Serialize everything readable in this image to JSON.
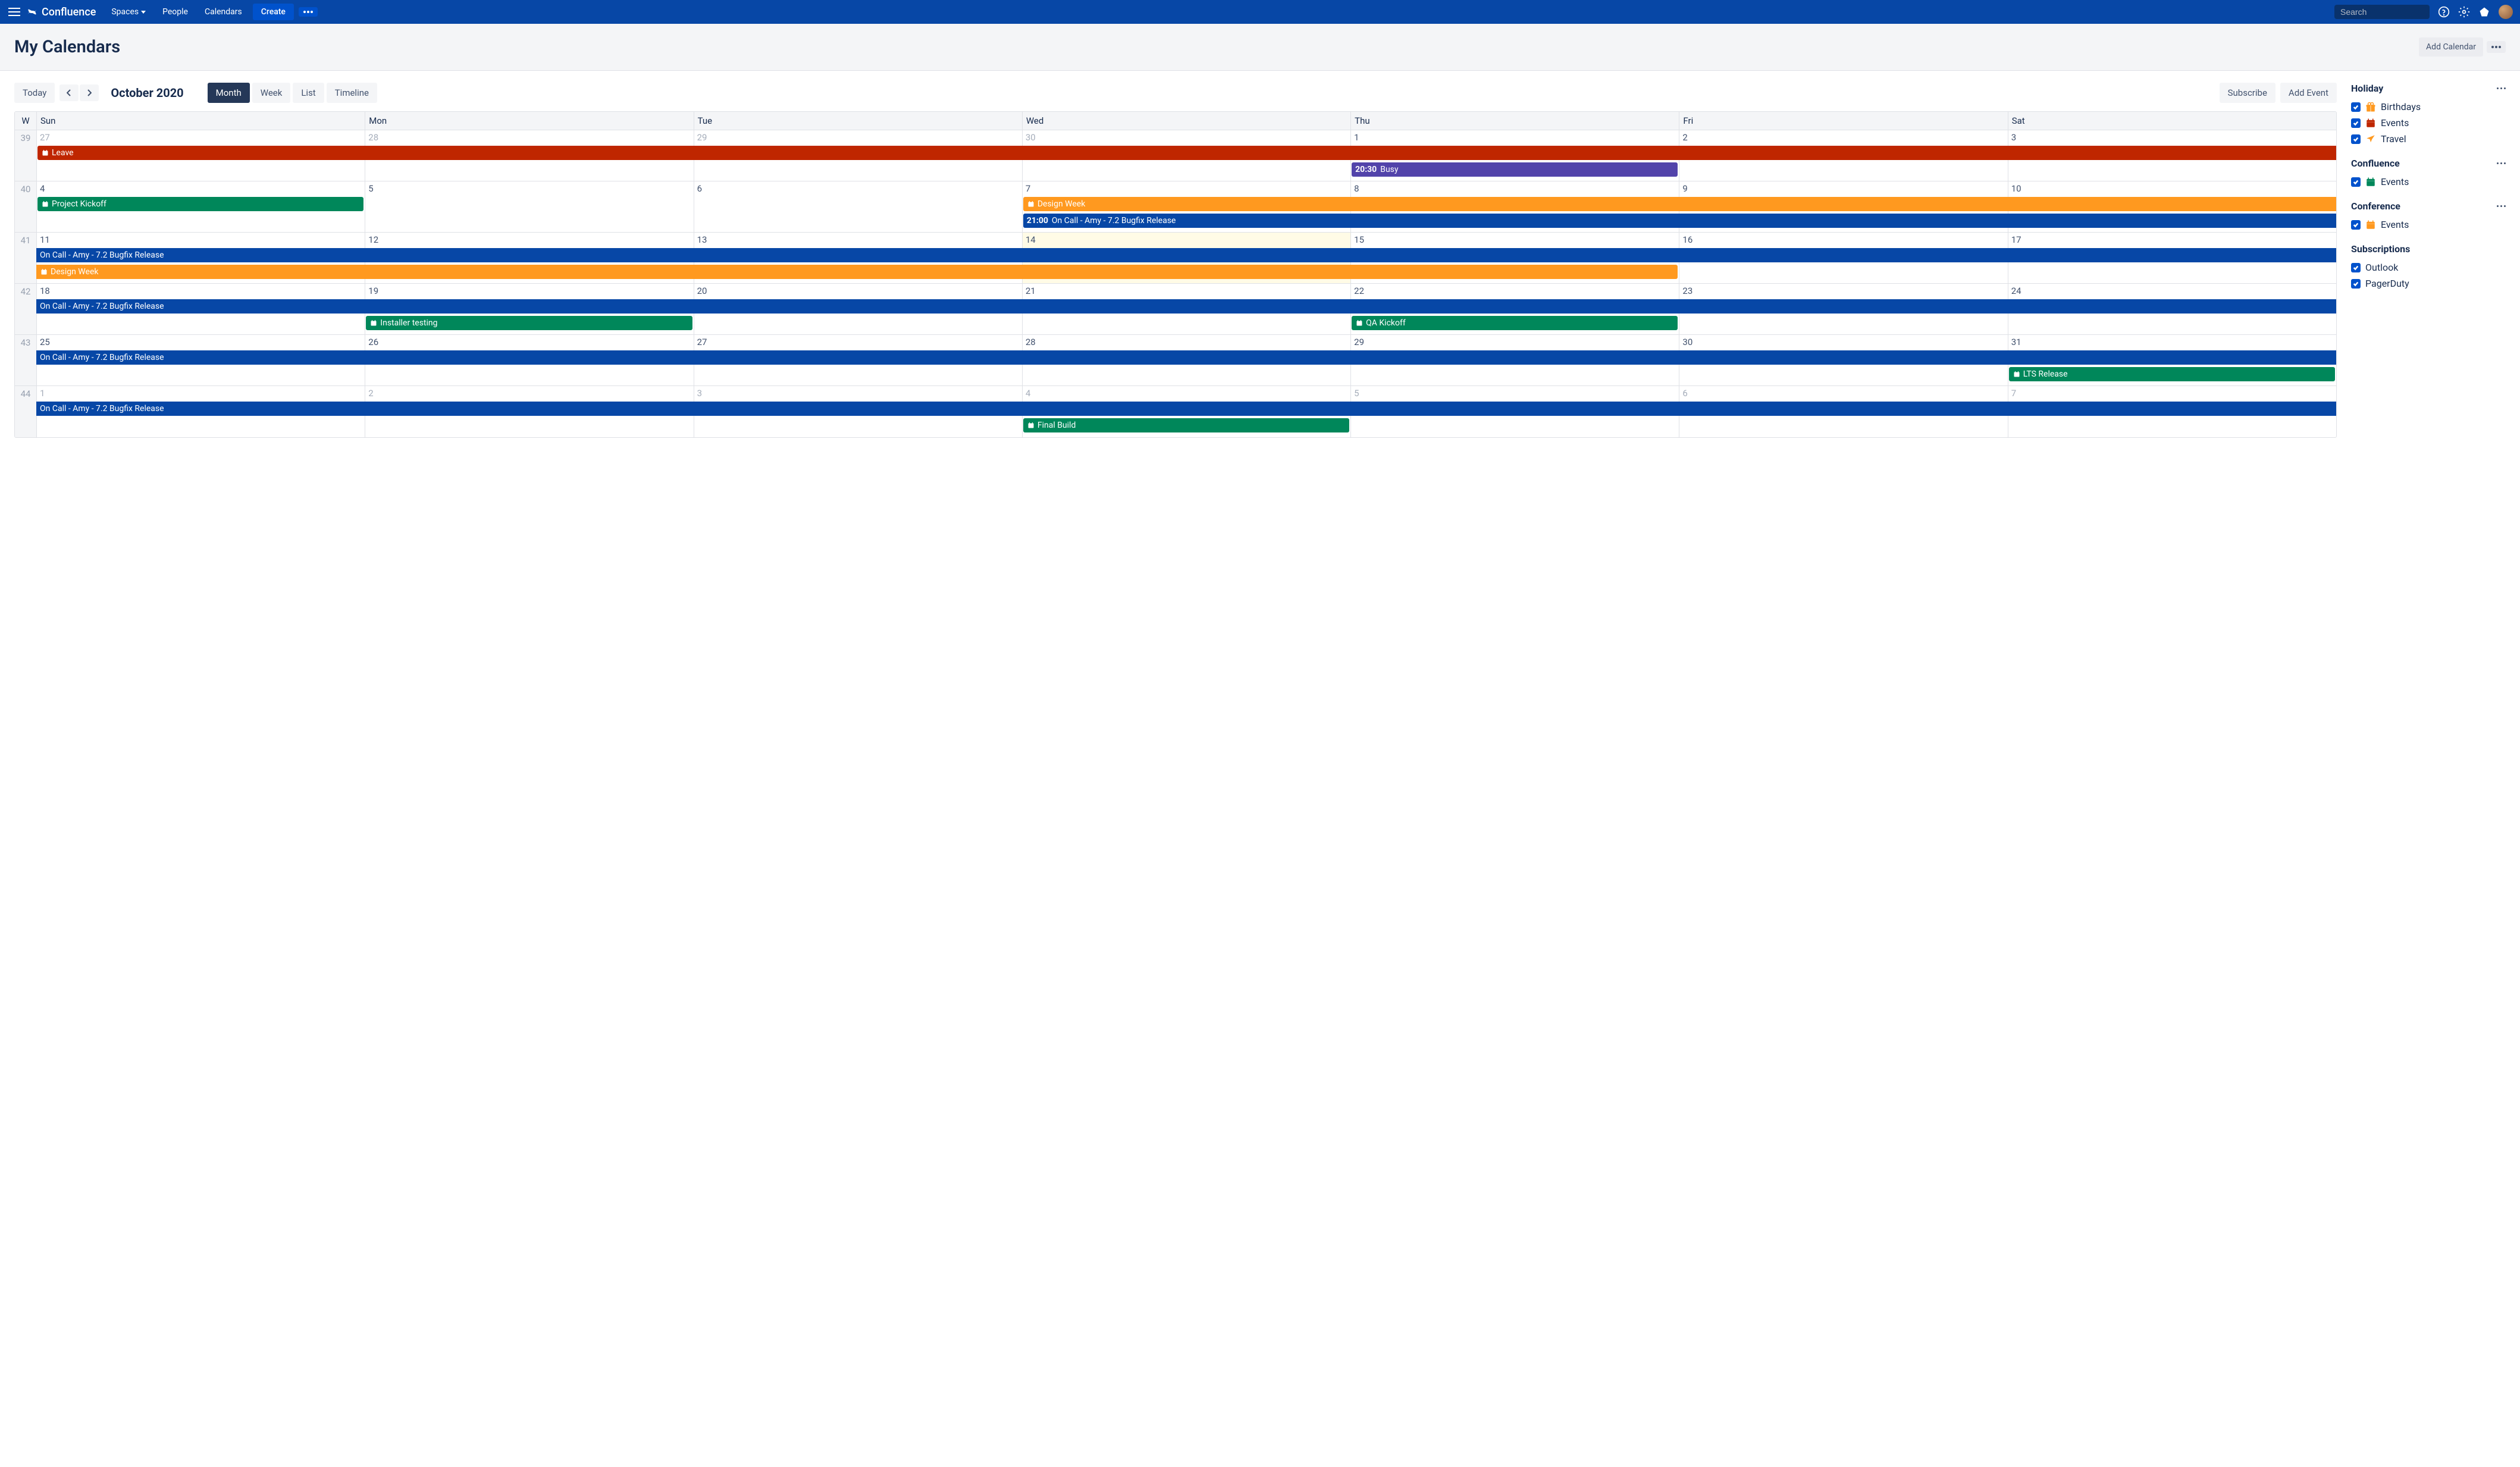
{
  "nav": {
    "logo": "Confluence",
    "items": [
      "Spaces",
      "People",
      "Calendars"
    ],
    "create": "Create",
    "search_placeholder": "Search"
  },
  "page": {
    "title": "My Calendars",
    "add_calendar": "Add Calendar"
  },
  "toolbar": {
    "today": "Today",
    "month_label": "October 2020",
    "views": [
      "Month",
      "Week",
      "List",
      "Timeline"
    ],
    "active_view": 0,
    "subscribe": "Subscribe",
    "add_event": "Add Event"
  },
  "calendar": {
    "day_headers": [
      "W",
      "Sun",
      "Mon",
      "Tue",
      "Wed",
      "Thu",
      "Fri",
      "Sat"
    ],
    "weeks": [
      {
        "num": "39",
        "days": [
          {
            "n": "27",
            "other": true
          },
          {
            "n": "28",
            "other": true
          },
          {
            "n": "29",
            "other": true
          },
          {
            "n": "30",
            "other": true
          },
          {
            "n": "1"
          },
          {
            "n": "2"
          },
          {
            "n": "3"
          }
        ],
        "events": [
          {
            "label": "Leave",
            "color": "#BF2600",
            "start": 0,
            "span": 7,
            "row": 0,
            "icon": true,
            "full_right": true
          },
          {
            "time": "20:30",
            "label": "Busy",
            "color": "#5243AA",
            "start": 4,
            "span": 1,
            "row": 1
          }
        ]
      },
      {
        "num": "40",
        "days": [
          {
            "n": "4"
          },
          {
            "n": "5"
          },
          {
            "n": "6"
          },
          {
            "n": "7"
          },
          {
            "n": "8"
          },
          {
            "n": "9"
          },
          {
            "n": "10"
          }
        ],
        "events": [
          {
            "label": "Project Kickoff",
            "color": "#00875A",
            "start": 0,
            "span": 1,
            "row": 0,
            "icon": true
          },
          {
            "label": "Design Week",
            "color": "#FF991F",
            "start": 3,
            "span": 4,
            "row": 0,
            "icon": true,
            "full_right": true
          },
          {
            "time": "21:00",
            "label": "On Call - Amy - 7.2 Bugfix Release",
            "color": "#0747A6",
            "start": 3,
            "span": 4,
            "row": 1,
            "full_right": true
          }
        ]
      },
      {
        "num": "41",
        "days": [
          {
            "n": "11"
          },
          {
            "n": "12"
          },
          {
            "n": "13"
          },
          {
            "n": "14",
            "today": true
          },
          {
            "n": "15"
          },
          {
            "n": "16"
          },
          {
            "n": "17"
          }
        ],
        "events": [
          {
            "label": "On Call - Amy - 7.2 Bugfix Release",
            "color": "#0747A6",
            "start": 0,
            "span": 7,
            "row": 0,
            "full_left": true,
            "full_right": true
          },
          {
            "label": "Design Week",
            "color": "#FF991F",
            "start": 0,
            "span": 5,
            "row": 1,
            "icon": true,
            "full_left": true
          }
        ]
      },
      {
        "num": "42",
        "days": [
          {
            "n": "18"
          },
          {
            "n": "19"
          },
          {
            "n": "20"
          },
          {
            "n": "21"
          },
          {
            "n": "22"
          },
          {
            "n": "23"
          },
          {
            "n": "24"
          }
        ],
        "events": [
          {
            "label": "On Call - Amy - 7.2 Bugfix Release",
            "color": "#0747A6",
            "start": 0,
            "span": 7,
            "row": 0,
            "full_left": true,
            "full_right": true
          },
          {
            "label": "Installer testing",
            "color": "#00875A",
            "start": 1,
            "span": 1,
            "row": 1,
            "icon": true
          },
          {
            "label": "QA Kickoff",
            "color": "#00875A",
            "start": 4,
            "span": 1,
            "row": 1,
            "icon": true
          }
        ]
      },
      {
        "num": "43",
        "days": [
          {
            "n": "25"
          },
          {
            "n": "26"
          },
          {
            "n": "27"
          },
          {
            "n": "28"
          },
          {
            "n": "29"
          },
          {
            "n": "30"
          },
          {
            "n": "31"
          }
        ],
        "events": [
          {
            "label": "On Call - Amy - 7.2 Bugfix Release",
            "color": "#0747A6",
            "start": 0,
            "span": 7,
            "row": 0,
            "full_left": true,
            "full_right": true
          },
          {
            "label": "LTS Release",
            "color": "#00875A",
            "start": 6,
            "span": 1,
            "row": 1,
            "icon": true
          }
        ]
      },
      {
        "num": "44",
        "days": [
          {
            "n": "1",
            "other": true
          },
          {
            "n": "2",
            "other": true
          },
          {
            "n": "3",
            "other": true
          },
          {
            "n": "4",
            "other": true
          },
          {
            "n": "5",
            "other": true
          },
          {
            "n": "6",
            "other": true
          },
          {
            "n": "7",
            "other": true
          }
        ],
        "events": [
          {
            "label": "On Call - Amy - 7.2 Bugfix Release",
            "color": "#0747A6",
            "start": 0,
            "span": 7,
            "row": 0,
            "full_left": true,
            "full_right": true
          },
          {
            "label": "Final Build",
            "color": "#00875A",
            "start": 3,
            "span": 1,
            "row": 1,
            "icon": true
          }
        ]
      }
    ]
  },
  "sidebar": {
    "groups": [
      {
        "title": "Holiday",
        "menu": true,
        "items": [
          {
            "label": "Birthdays",
            "icon": "gift",
            "color": "#FF991F"
          },
          {
            "label": "Events",
            "icon": "cal",
            "color": "#BF2600"
          },
          {
            "label": "Travel",
            "icon": "plane",
            "color": "#FF991F"
          }
        ]
      },
      {
        "title": "Confluence",
        "menu": true,
        "items": [
          {
            "label": "Events",
            "icon": "cal",
            "color": "#00875A"
          }
        ]
      },
      {
        "title": "Conference",
        "menu": true,
        "items": [
          {
            "label": "Events",
            "icon": "cal",
            "color": "#FF991F"
          }
        ]
      },
      {
        "title": "Subscriptions",
        "items": [
          {
            "label": "Outlook"
          },
          {
            "label": "PagerDuty"
          }
        ]
      }
    ]
  }
}
